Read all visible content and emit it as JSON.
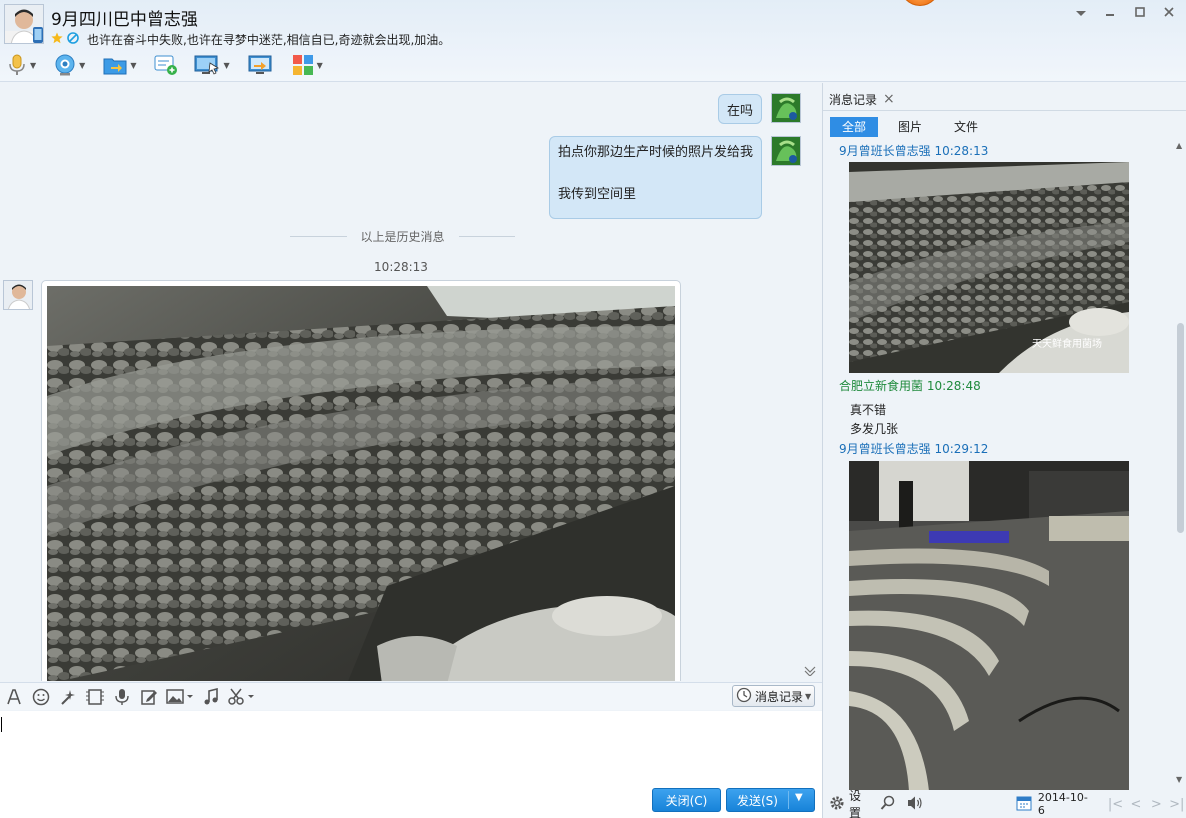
{
  "header": {
    "contact_name": "9月四川巴中曾志强",
    "signature": "也许在奋斗中失败,也许在寻梦中迷茫,相信自已,奇迹就会出现,加油。"
  },
  "chat": {
    "messages_right": [
      {
        "text": "在吗"
      },
      {
        "line1": "拍点你那边生产时候的照片发给我",
        "line2": "我传到空间里"
      }
    ],
    "history_divider": "以上是历史消息",
    "incoming_time": "10:28:13"
  },
  "input": {
    "history_button_label": "消息记录",
    "close_button": "关闭(C)",
    "send_button": "发送(S)"
  },
  "right_panel": {
    "tab_label": "消息记录",
    "filters": [
      "全部",
      "图片",
      "文件"
    ],
    "entries": [
      {
        "sender": "9月曾班长曾志强",
        "time": "10:28:13",
        "watermark": "天天鲜食用菌场"
      },
      {
        "sender": "合肥立新食用菌",
        "time": "10:28:48",
        "lines": [
          "真不错",
          "多发几张"
        ]
      },
      {
        "sender": "9月曾班长曾志强",
        "time": "10:29:12"
      }
    ],
    "settings_label": "设置",
    "date": "2014-10-6"
  },
  "colors": {
    "accent": "#2f8de4",
    "bubble": "#d3e7f7",
    "sender_self": "#1f8a3c",
    "sender_other": "#1a6fb8"
  }
}
